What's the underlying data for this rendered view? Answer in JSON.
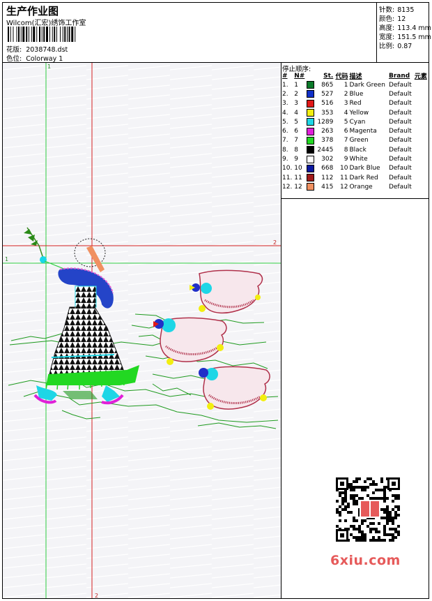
{
  "header": {
    "title": "生产作业图",
    "studio": "Wilcom(汇宏)绣饰工作室",
    "design_label": "花版:",
    "design_value": "2038748.dst",
    "colorway_label": "色位:",
    "colorway_value": "Colorway 1"
  },
  "specs": [
    {
      "label": "针数:",
      "value": "8135"
    },
    {
      "label": "颜色:",
      "value": "12"
    },
    {
      "label": "高度:",
      "value": "113.4 mm"
    },
    {
      "label": "宽度:",
      "value": "151.5 mm"
    },
    {
      "label": "比例:",
      "value": "0.87"
    }
  ],
  "canvas": {
    "marker_1_top": "1",
    "marker_1_left": "1",
    "marker_2_right": "2",
    "marker_2_bottom": "2"
  },
  "stop_sequence": {
    "title": "停止顺序:",
    "headers": [
      "#",
      "N#",
      "St.",
      "代码",
      "描述",
      "Brand",
      "元素"
    ],
    "rows": [
      {
        "idx": "1.",
        "n": "1",
        "st": "865",
        "code": "1",
        "desc": "Dark Green",
        "brand": "Default",
        "color": "#0b7a2a"
      },
      {
        "idx": "2.",
        "n": "2",
        "st": "527",
        "code": "2",
        "desc": "Blue",
        "brand": "Default",
        "color": "#1030c8"
      },
      {
        "idx": "3.",
        "n": "3",
        "st": "516",
        "code": "3",
        "desc": "Red",
        "brand": "Default",
        "color": "#e01818"
      },
      {
        "idx": "4.",
        "n": "4",
        "st": "353",
        "code": "4",
        "desc": "Yellow",
        "brand": "Default",
        "color": "#f2ee10"
      },
      {
        "idx": "5.",
        "n": "5",
        "st": "1289",
        "code": "5",
        "desc": "Cyan",
        "brand": "Default",
        "color": "#1ed6e6"
      },
      {
        "idx": "6.",
        "n": "6",
        "st": "263",
        "code": "6",
        "desc": "Magenta",
        "brand": "Default",
        "color": "#e020d8"
      },
      {
        "idx": "7.",
        "n": "7",
        "st": "378",
        "code": "7",
        "desc": "Green",
        "brand": "Default",
        "color": "#22d822"
      },
      {
        "idx": "8.",
        "n": "8",
        "st": "2445",
        "code": "8",
        "desc": "Black",
        "brand": "Default",
        "color": "#000000"
      },
      {
        "idx": "9.",
        "n": "9",
        "st": "302",
        "code": "9",
        "desc": "White",
        "brand": "Default",
        "color": "#ffffff"
      },
      {
        "idx": "10.",
        "n": "10",
        "st": "668",
        "code": "10",
        "desc": "Dark Blue",
        "brand": "Default",
        "color": "#0a18a0"
      },
      {
        "idx": "11.",
        "n": "11",
        "st": "112",
        "code": "11",
        "desc": "Dark Red",
        "brand": "Default",
        "color": "#a01a1a"
      },
      {
        "idx": "12.",
        "n": "12",
        "st": "415",
        "code": "12",
        "desc": "Orange",
        "brand": "Default",
        "color": "#f09060"
      }
    ]
  },
  "watermark": "6xiu.com"
}
